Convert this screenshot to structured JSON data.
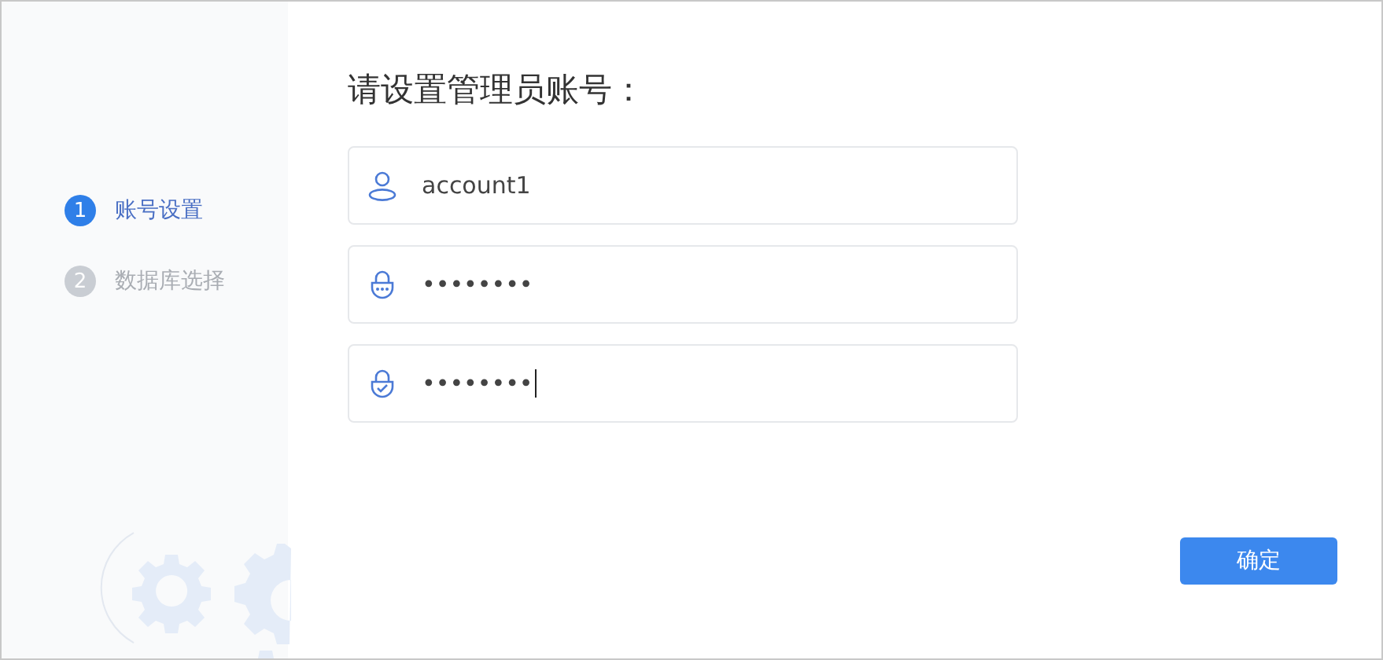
{
  "steps": [
    {
      "number": "1",
      "label": "账号设置",
      "selected": true
    },
    {
      "number": "2",
      "label": "数据库选择",
      "selected": false
    }
  ],
  "title": "请设置管理员账号：",
  "fields": [
    {
      "kind": "user",
      "value": "account1",
      "focused": false
    },
    {
      "kind": "lock",
      "value": "••••••••",
      "focused": false
    },
    {
      "kind": "lock-check",
      "value": "••••••••",
      "focused": true
    }
  ],
  "confirm_button": "确定"
}
